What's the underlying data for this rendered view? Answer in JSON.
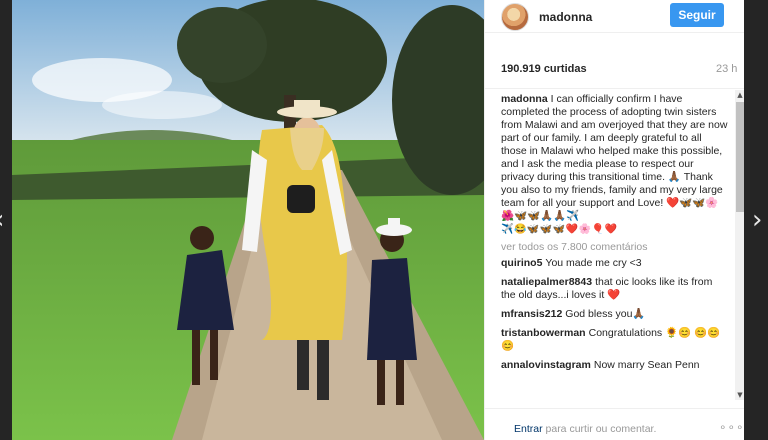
{
  "nav": {
    "prev_icon": "chevron-left-icon",
    "next_icon": "chevron-right-icon",
    "prev_glyph": "‹",
    "next_glyph": "›"
  },
  "post": {
    "username": "madonna",
    "follow_label": "Seguir",
    "likes": "190.919 curtidas",
    "time_ago": "23 h",
    "caption_user": "madonna",
    "caption": "I can officially confirm I have completed the process of adopting twin sisters from Malawi and am overjoyed that they are now part of our family. I am deeply grateful to all those in Malawi who helped make this possible, and I ask the media please to respect our privacy during this transitional time. 🙏🏾 Thank you also to my friends, family and my very large team for all your support and Love! ❤️🦋🦋🌸🌺🦋🦋🙏🏾🙏🏾✈️",
    "caption_emojis": "✈️😂🦋🦋🦋❤️🌸🎈❤️",
    "view_all": "ver todos os 7.800 comentários"
  },
  "comments": [
    {
      "user": "quirino5",
      "text": "You made me cry <3"
    },
    {
      "user": "nataliepalmer8843",
      "text": "that oic looks like its from the old days...i loves it ❤️"
    },
    {
      "user": "mfransis212",
      "text": "God bless you🙏🏾"
    },
    {
      "user": "tristanbowerman",
      "text": "Congratulations 🌻😊 😊😊😊"
    },
    {
      "user": "annalovinstagram",
      "text": "Now marry Sean Penn"
    }
  ],
  "footer": {
    "login_link": "Entrar",
    "login_text": " para curtir ou comentar.",
    "more_glyph": "∘∘∘"
  },
  "scroll": {
    "up_glyph": "▲",
    "down_glyph": "▼"
  },
  "colors": {
    "follow_button": "#3897f0",
    "link": "#003569",
    "muted": "#999999"
  }
}
